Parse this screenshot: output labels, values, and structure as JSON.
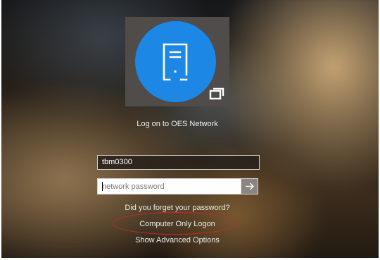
{
  "login": {
    "title": "Log on to OES Network",
    "username_value": "tbm0300",
    "password_placeholder": "network password",
    "submit_icon": "arrow-right-icon"
  },
  "links": {
    "forgot_password": "Did you forget your password?",
    "computer_only_logon": "Computer Only Logon",
    "show_advanced_options": "Show Advanced Options"
  },
  "icons": {
    "avatar": "server-tower-icon",
    "badge": "window-icon"
  },
  "colors": {
    "accent": "#1d87e6",
    "tile": "#4f4c49",
    "annotation": "#d9212a",
    "submit_button": "#8a8580"
  }
}
